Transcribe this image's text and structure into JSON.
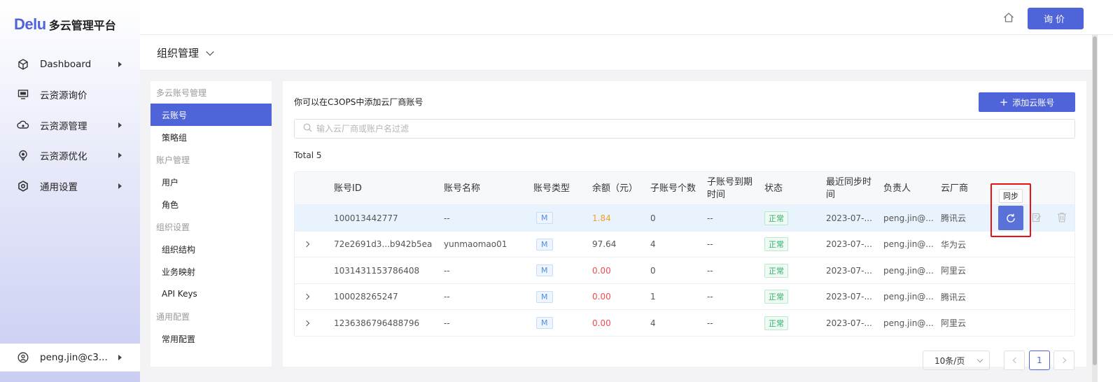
{
  "app": {
    "brand": "Delu",
    "title": "多云管理平台"
  },
  "sidebar": {
    "items": [
      {
        "label": "Dashboard",
        "icon": "cube-icon"
      },
      {
        "label": "云资源询价",
        "icon": "monitor-icon"
      },
      {
        "label": "云资源管理",
        "icon": "cloud-icon"
      },
      {
        "label": "云资源优化",
        "icon": "rocket-icon"
      },
      {
        "label": "通用设置",
        "icon": "gear-icon"
      }
    ],
    "user": "peng.jin@c3..."
  },
  "header": {
    "quote_button": "询价"
  },
  "page": {
    "title": "组织管理"
  },
  "submenu": {
    "groups": [
      {
        "label": "多云账号管理",
        "items": [
          "云账号",
          "策略组"
        ]
      },
      {
        "label": "账户管理",
        "items": [
          "用户",
          "角色"
        ]
      },
      {
        "label": "组织设置",
        "items": [
          "组织结构",
          "业务映射",
          "API Keys"
        ]
      },
      {
        "label": "通用配置",
        "items": [
          "常用配置"
        ]
      }
    ],
    "active": "云账号"
  },
  "main": {
    "hint": "你可以在C3OPS中添加云厂商账号",
    "add_button": "添加云账号",
    "search_placeholder": "输入云厂商或账户名过滤",
    "total": "Total 5",
    "columns": [
      "账号ID",
      "账号名称",
      "账号类型",
      "余额（元）",
      "子账号个数",
      "子账号到期时间",
      "状态",
      "最近同步时间",
      "负责人",
      "云厂商"
    ],
    "rows": [
      {
        "expandable": false,
        "id": "100013442777",
        "name": "--",
        "type": "M",
        "balance": "1.84",
        "balance_color": "orange",
        "sub_count": "0",
        "expiry": "--",
        "status": "正常",
        "last_sync": "2023-07-...",
        "owner": "peng.jin@...",
        "vendor": "腾讯云",
        "highlighted": true
      },
      {
        "expandable": true,
        "id": "72e2691d3...b942b5ea",
        "name": "yunmaomao01",
        "type": "M",
        "balance": "97.64",
        "balance_color": "normal",
        "sub_count": "4",
        "expiry": "--",
        "status": "正常",
        "last_sync": "2023-07-...",
        "owner": "peng.jin@...",
        "vendor": "华为云",
        "highlighted": false
      },
      {
        "expandable": false,
        "id": "1031431153786408",
        "name": "--",
        "type": "M",
        "balance": "0.00",
        "balance_color": "red",
        "sub_count": "0",
        "expiry": "--",
        "status": "正常",
        "last_sync": "2023-07-...",
        "owner": "peng.jin@...",
        "vendor": "阿里云",
        "highlighted": false
      },
      {
        "expandable": true,
        "id": "100028265247",
        "name": "--",
        "type": "M",
        "balance": "0.00",
        "balance_color": "red",
        "sub_count": "1",
        "expiry": "--",
        "status": "正常",
        "last_sync": "2023-07-...",
        "owner": "peng.jin@...",
        "vendor": "腾讯云",
        "highlighted": false
      },
      {
        "expandable": true,
        "id": "1236386796488796",
        "name": "--",
        "type": "M",
        "balance": "0.00",
        "balance_color": "red",
        "sub_count": "4",
        "expiry": "--",
        "status": "正常",
        "last_sync": "2023-07-...",
        "owner": "peng.jin@...",
        "vendor": "阿里云",
        "highlighted": false
      }
    ],
    "sync_tooltip": "同步"
  },
  "pagination": {
    "page_size": "10条/页",
    "current_page": "1"
  },
  "colors": {
    "accent": "#4f64d8",
    "status_ok": "#30b069",
    "balance_zero": "#f04b4b",
    "balance_low": "#f0a020",
    "highlight": "#e11111"
  }
}
